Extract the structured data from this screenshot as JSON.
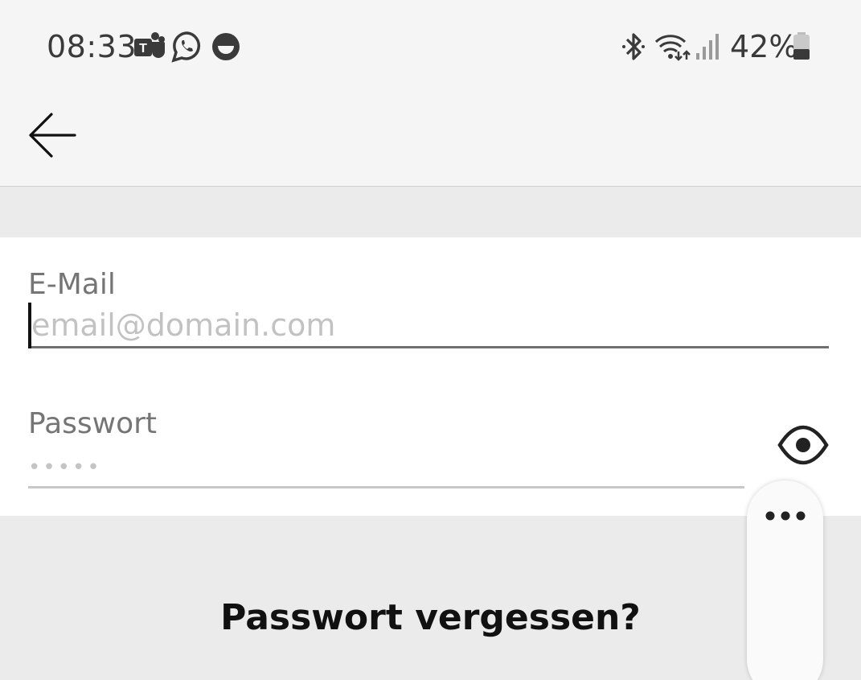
{
  "status_bar": {
    "time": "08:33",
    "battery_percent": "42%",
    "battery_level": 0.42,
    "notification_icons": [
      "teams-icon",
      "whatsapp-icon",
      "smiley-app-icon"
    ],
    "system_icons": [
      "bluetooth-icon",
      "wifi-data-icon",
      "signal-icon",
      "battery-icon"
    ]
  },
  "app_bar": {
    "back_icon": "arrow-left-icon"
  },
  "form": {
    "email": {
      "label": "E-Mail",
      "placeholder": "email@domain.com",
      "value": ""
    },
    "password": {
      "label": "Passwort",
      "placeholder": "•••••",
      "value": "",
      "toggle_icon": "eye-icon"
    }
  },
  "links": {
    "forgot_password": "Passwort vergessen?"
  },
  "floating_menu": {
    "icon": "more-horizontal-icon"
  },
  "colors": {
    "header_bg": "#f5f5f5",
    "page_bg": "#ebebeb",
    "form_bg": "#ffffff",
    "label_text": "#757575",
    "placeholder_text": "#c2c2c2",
    "primary_text": "#111111"
  }
}
